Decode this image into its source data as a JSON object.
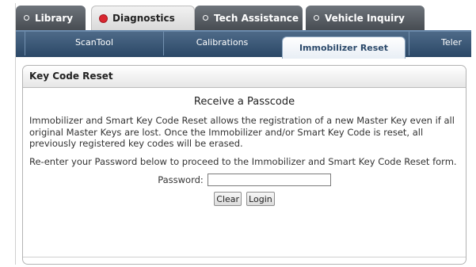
{
  "top_tabs": [
    {
      "label": "Library",
      "active": false
    },
    {
      "label": "Diagnostics",
      "active": true
    },
    {
      "label": "Tech Assistance",
      "active": false
    },
    {
      "label": "Vehicle Inquiry",
      "active": false
    }
  ],
  "sub_tabs": [
    {
      "label": "ScanTool",
      "active": false
    },
    {
      "label": "Calibrations",
      "active": false
    },
    {
      "label": "Immobilizer Reset",
      "active": true
    },
    {
      "label": "Teler",
      "active": false
    }
  ],
  "panel": {
    "title": "Key Code Reset",
    "subtitle": "Receive a Passcode",
    "paragraph1": "Immobilizer and Smart Key Code Reset allows the registration of a new Master Key even if all original Master Keys are lost. Once the Immobilizer and/or Smart Key Code is reset, all previously registered key codes will be erased.",
    "paragraph2": "Re-enter your Password below to proceed to the Immobilizer and Smart Key Code Reset form.",
    "password_label": "Password:",
    "password_value": "",
    "clear_label": "Clear",
    "login_label": "Login"
  },
  "colors": {
    "tab_dark": "#52575d",
    "active_dot": "#d9262f",
    "subbar": "#3a5778",
    "active_subtab_text": "#2c4a6b"
  }
}
